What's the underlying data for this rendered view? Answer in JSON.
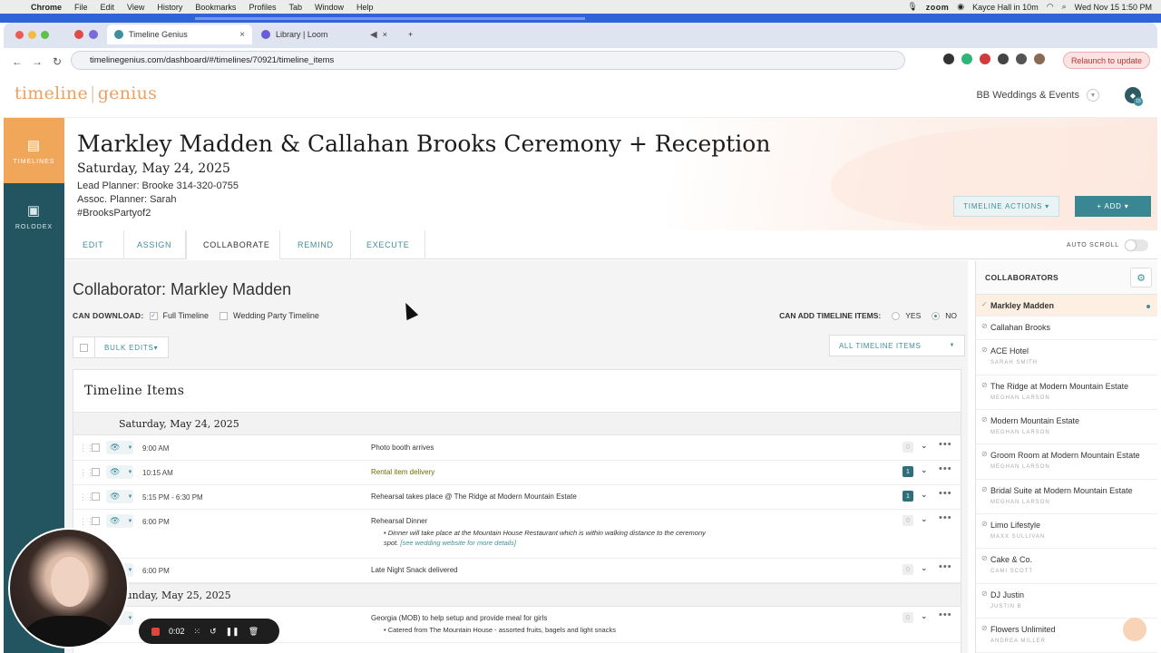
{
  "menubar": {
    "app": "Chrome",
    "items": [
      "File",
      "Edit",
      "View",
      "History",
      "Bookmarks",
      "Profiles",
      "Tab",
      "Window",
      "Help"
    ],
    "zoom": "zoom",
    "meeting": "Kayce Hall in 10m",
    "clock": "Wed Nov 15  1:50 PM"
  },
  "browser": {
    "tabs": [
      {
        "label": "Timeline Genius",
        "active": true
      },
      {
        "label": "Library | Loom",
        "active": false
      }
    ],
    "url": "timelinegenius.com/dashboard/#/timelines/70921/timeline_items",
    "relaunch": "Relaunch to update"
  },
  "app": {
    "logo_left": "timeline",
    "logo_right": "genius",
    "company": "BB Weddings & Events",
    "notif_count": "15",
    "sidebar": [
      {
        "label": "TIMELINES",
        "icon": "timelines-icon"
      },
      {
        "label": "ROLODEX",
        "icon": "rolodex-icon"
      }
    ]
  },
  "hero": {
    "title": "Markley Madden & Callahan Brooks Ceremony + Reception",
    "date": "Saturday, May 24, 2025",
    "lead": "Lead Planner: Brooke 314-320-0755",
    "assoc": "Assoc. Planner: Sarah",
    "hashtag": "#BrooksPartyof2",
    "actions": "TIMELINE ACTIONS ▾",
    "add": "+ ADD ▾"
  },
  "navtabs": [
    "EDIT",
    "ASSIGN",
    "COLLABORATE",
    "REMIND",
    "EXECUTE"
  ],
  "autoscroll": "AUTO SCROLL",
  "collab": {
    "title": "Collaborator: Markley Madden",
    "can_download": "CAN DOWNLOAD:",
    "full": "Full Timeline",
    "party": "Wedding Party Timeline",
    "can_add": "CAN ADD TIMELINE ITEMS:",
    "yes": "YES",
    "no": "NO",
    "bulk": "BULK EDITS▾",
    "all_items": "ALL TIMELINE ITEMS"
  },
  "timeline": {
    "title": "Timeline Items",
    "day1": "Saturday, May 24, 2025",
    "day2": "Sunday, May 25, 2025",
    "rows": [
      {
        "time": "9:00 AM",
        "desc": "Photo booth arrives",
        "count": "0"
      },
      {
        "time": "10:15 AM",
        "desc": "Rental item delivery",
        "count": "1"
      },
      {
        "time": "5:15 PM - 6:30 PM",
        "desc": "Rehearsal takes place @ The Ridge at Modern Mountain Estate",
        "count": "1"
      },
      {
        "time": "6:00 PM",
        "desc": "Rehearsal Dinner",
        "count": "0",
        "note": "Dinner will take place at the Mountain House Restaurant which is within walking distance to the ceremony spot.",
        "link": "[see wedding website for more details]"
      },
      {
        "time": "6:00 PM",
        "desc": "Late Night Snack delivered",
        "count": "0"
      },
      {
        "time": "",
        "desc": "Georgia (MOB) to help setup and provide meal for girls",
        "count": "0",
        "note": "Catered from The Mountain House - assorted fruits, bagels and light snacks"
      }
    ]
  },
  "collaborators": {
    "header": "COLLABORATORS",
    "items": [
      {
        "name": "Markley Madden",
        "sub": ""
      },
      {
        "name": "Callahan Brooks",
        "sub": ""
      },
      {
        "name": "ACE Hotel",
        "sub": "SARAH SMITH"
      },
      {
        "name": "The Ridge at Modern Mountain Estate",
        "sub": "MEGHAN LARSON"
      },
      {
        "name": "Modern Mountain Estate",
        "sub": "MEGHAN LARSON"
      },
      {
        "name": "Groom Room at Modern Mountain Estate",
        "sub": "MEGHAN LARSON"
      },
      {
        "name": "Bridal Suite at Modern Mountain Estate",
        "sub": "MEGHAN LARSON"
      },
      {
        "name": "Limo Lifestyle",
        "sub": "MAXX SULLIVAN"
      },
      {
        "name": "Cake & Co.",
        "sub": "CAMI SCOTT"
      },
      {
        "name": "DJ Justin",
        "sub": "JUSTIN B"
      },
      {
        "name": "Flowers Unlimited",
        "sub": "ANDREA MILLER"
      }
    ]
  },
  "recorder": {
    "time": "0:02"
  },
  "colors": {
    "accent": "#3f8f9c",
    "sidebar": "#235560",
    "orange": "#f0a759"
  }
}
